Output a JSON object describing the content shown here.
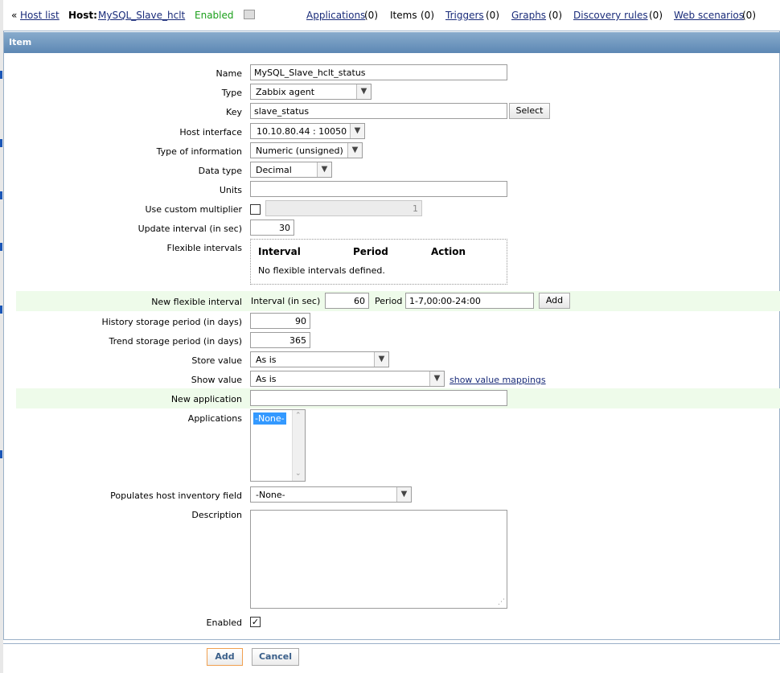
{
  "nav": {
    "back_arrow": "«",
    "host_list": "Host list",
    "host_label": "Host:",
    "host_name": "MySQL_Slave_hclt",
    "status": "Enabled",
    "status_color": "#1a9f1a",
    "applications": "Applications",
    "applications_count": "(0)",
    "items": "Items",
    "items_count": "(0)",
    "triggers": "Triggers",
    "triggers_count": "(0)",
    "graphs": "Graphs",
    "graphs_count": "(0)",
    "discovery": "Discovery rules",
    "discovery_count": "(0)",
    "web": "Web scenarios",
    "web_count": "(0)"
  },
  "panel": {
    "title": "Item"
  },
  "form": {
    "name_label": "Name",
    "name_value": "MySQL_Slave_hclt_status",
    "type_label": "Type",
    "type_value": "Zabbix agent",
    "key_label": "Key",
    "key_value": "slave_status",
    "key_select": "Select",
    "iface_label": "Host interface",
    "iface_value": "10.10.80.44 : 10050",
    "toi_label": "Type of information",
    "toi_value": "Numeric (unsigned)",
    "datatype_label": "Data type",
    "datatype_value": "Decimal",
    "units_label": "Units",
    "units_value": "",
    "multiplier_label": "Use custom multiplier",
    "multiplier_value": "1",
    "update_label": "Update interval (in sec)",
    "update_value": "30",
    "flex_label": "Flexible intervals",
    "flex_col_interval": "Interval",
    "flex_col_period": "Period",
    "flex_col_action": "Action",
    "flex_empty": "No flexible intervals defined.",
    "newflex_label": "New flexible interval",
    "newflex_interval_label": "Interval (in sec)",
    "newflex_interval_value": "60",
    "newflex_period_label": "Period",
    "newflex_period_value": "1-7,00:00-24:00",
    "newflex_add": "Add",
    "history_label": "History storage period (in days)",
    "history_value": "90",
    "trend_label": "Trend storage period (in days)",
    "trend_value": "365",
    "store_label": "Store value",
    "store_value": "As is",
    "show_label": "Show value",
    "show_value": "As is",
    "show_mappings": "show value mappings",
    "newapp_label": "New application",
    "newapp_value": "",
    "apps_label": "Applications",
    "apps_option": "-None-",
    "inventory_label": "Populates host inventory field",
    "inventory_value": "-None-",
    "desc_label": "Description",
    "desc_value": "",
    "enabled_label": "Enabled",
    "enabled_check": "✓"
  },
  "footer": {
    "add": "Add",
    "cancel": "Cancel"
  },
  "colors": {
    "title_bar": "#6b93bd",
    "highlight_row": "#eefbea",
    "link": "#1a2c7a"
  }
}
